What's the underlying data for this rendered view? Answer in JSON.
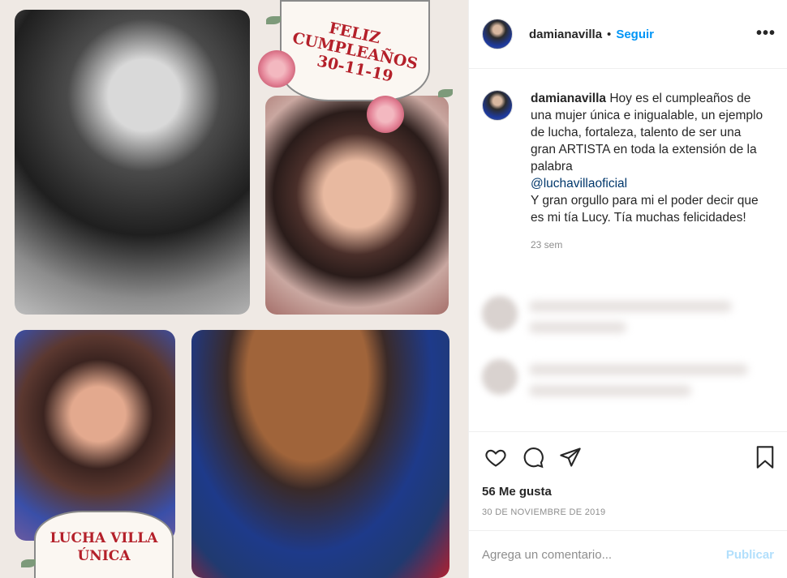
{
  "post": {
    "image": {
      "badge_top_lines": [
        "FELIZ",
        "CUMPLEAÑOS",
        "30-11-19"
      ],
      "badge_bottom_lines": [
        "LUCHA VILLA",
        "ÚNICA"
      ]
    },
    "header": {
      "username": "damianavilla",
      "separator": "•",
      "follow_label": "Seguir",
      "more_icon": "•••"
    },
    "caption": {
      "username": "damianavilla",
      "text_1": "Hoy es el cumpleaños de una mujer única e inigualable, un ejemplo de lucha, fortaleza, talento de ser una gran ARTISTA en toda la extensión de la palabra",
      "mention": "@luchavillaoficial",
      "text_2": "Y gran orgullo para mi el poder decir que es mi tía Lucy. Tía muchas felicidades!",
      "time": "23 sem"
    },
    "actions": {
      "like_icon": "heart-icon",
      "comment_icon": "comment-icon",
      "share_icon": "share-icon",
      "save_icon": "bookmark-icon"
    },
    "likes": "56 Me gusta",
    "date": "30 DE NOVIEMBRE DE 2019",
    "comment_box": {
      "placeholder": "Agrega un comentario...",
      "publish_label": "Publicar"
    },
    "colors": {
      "accent": "#0095f6",
      "mention": "#00376b",
      "publish_disabled": "#b2dffc",
      "badge_text": "#b4202a"
    }
  }
}
